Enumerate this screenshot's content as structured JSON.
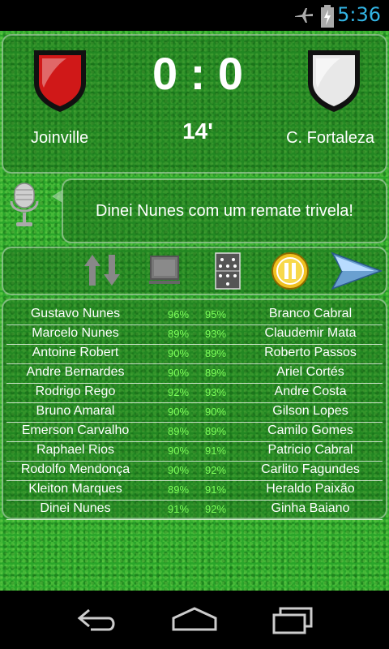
{
  "status_bar": {
    "time": "5:36",
    "icons": [
      "airplane-mode-icon",
      "battery-charging-icon"
    ]
  },
  "match": {
    "home_team": "Joinville",
    "away_team": "C. Fortaleza",
    "score": "0 : 0",
    "minute": "14'",
    "home_color": "#d01818",
    "away_color": "#e8e8e8"
  },
  "commentary": {
    "text": "Dinei Nunes com um remate trivela!"
  },
  "controls": [
    "substitution-arrows-icon",
    "tactics-board-icon",
    "formation-field-icon",
    "pause-button-icon",
    "play-next-icon"
  ],
  "players": [
    {
      "home": "Gustavo Nunes",
      "home_pct": "96%",
      "away_pct": "95%",
      "away": "Branco Cabral"
    },
    {
      "home": "Marcelo Nunes",
      "home_pct": "89%",
      "away_pct": "93%",
      "away": "Claudemir Mata"
    },
    {
      "home": "Antoine Robert",
      "home_pct": "90%",
      "away_pct": "89%",
      "away": "Roberto Passos"
    },
    {
      "home": "Andre Bernardes",
      "home_pct": "90%",
      "away_pct": "89%",
      "away": "Ariel Cortés"
    },
    {
      "home": "Rodrigo Rego",
      "home_pct": "92%",
      "away_pct": "93%",
      "away": "Andre Costa"
    },
    {
      "home": "Bruno Amaral",
      "home_pct": "90%",
      "away_pct": "90%",
      "away": "Gilson Lopes"
    },
    {
      "home": "Emerson Carvalho",
      "home_pct": "89%",
      "away_pct": "89%",
      "away": "Camilo Gomes"
    },
    {
      "home": "Raphael Rios",
      "home_pct": "90%",
      "away_pct": "91%",
      "away": "Patricio Cabral"
    },
    {
      "home": "Rodolfo Mendonça",
      "home_pct": "90%",
      "away_pct": "92%",
      "away": "Carlito Fagundes"
    },
    {
      "home": "Kleiton Marques",
      "home_pct": "89%",
      "away_pct": "91%",
      "away": "Heraldo Paixão"
    },
    {
      "home": "Dinei Nunes",
      "home_pct": "91%",
      "away_pct": "92%",
      "away": "Ginha Baiano"
    }
  ],
  "nav_bar": [
    "back-icon",
    "home-icon",
    "recent-apps-icon"
  ]
}
